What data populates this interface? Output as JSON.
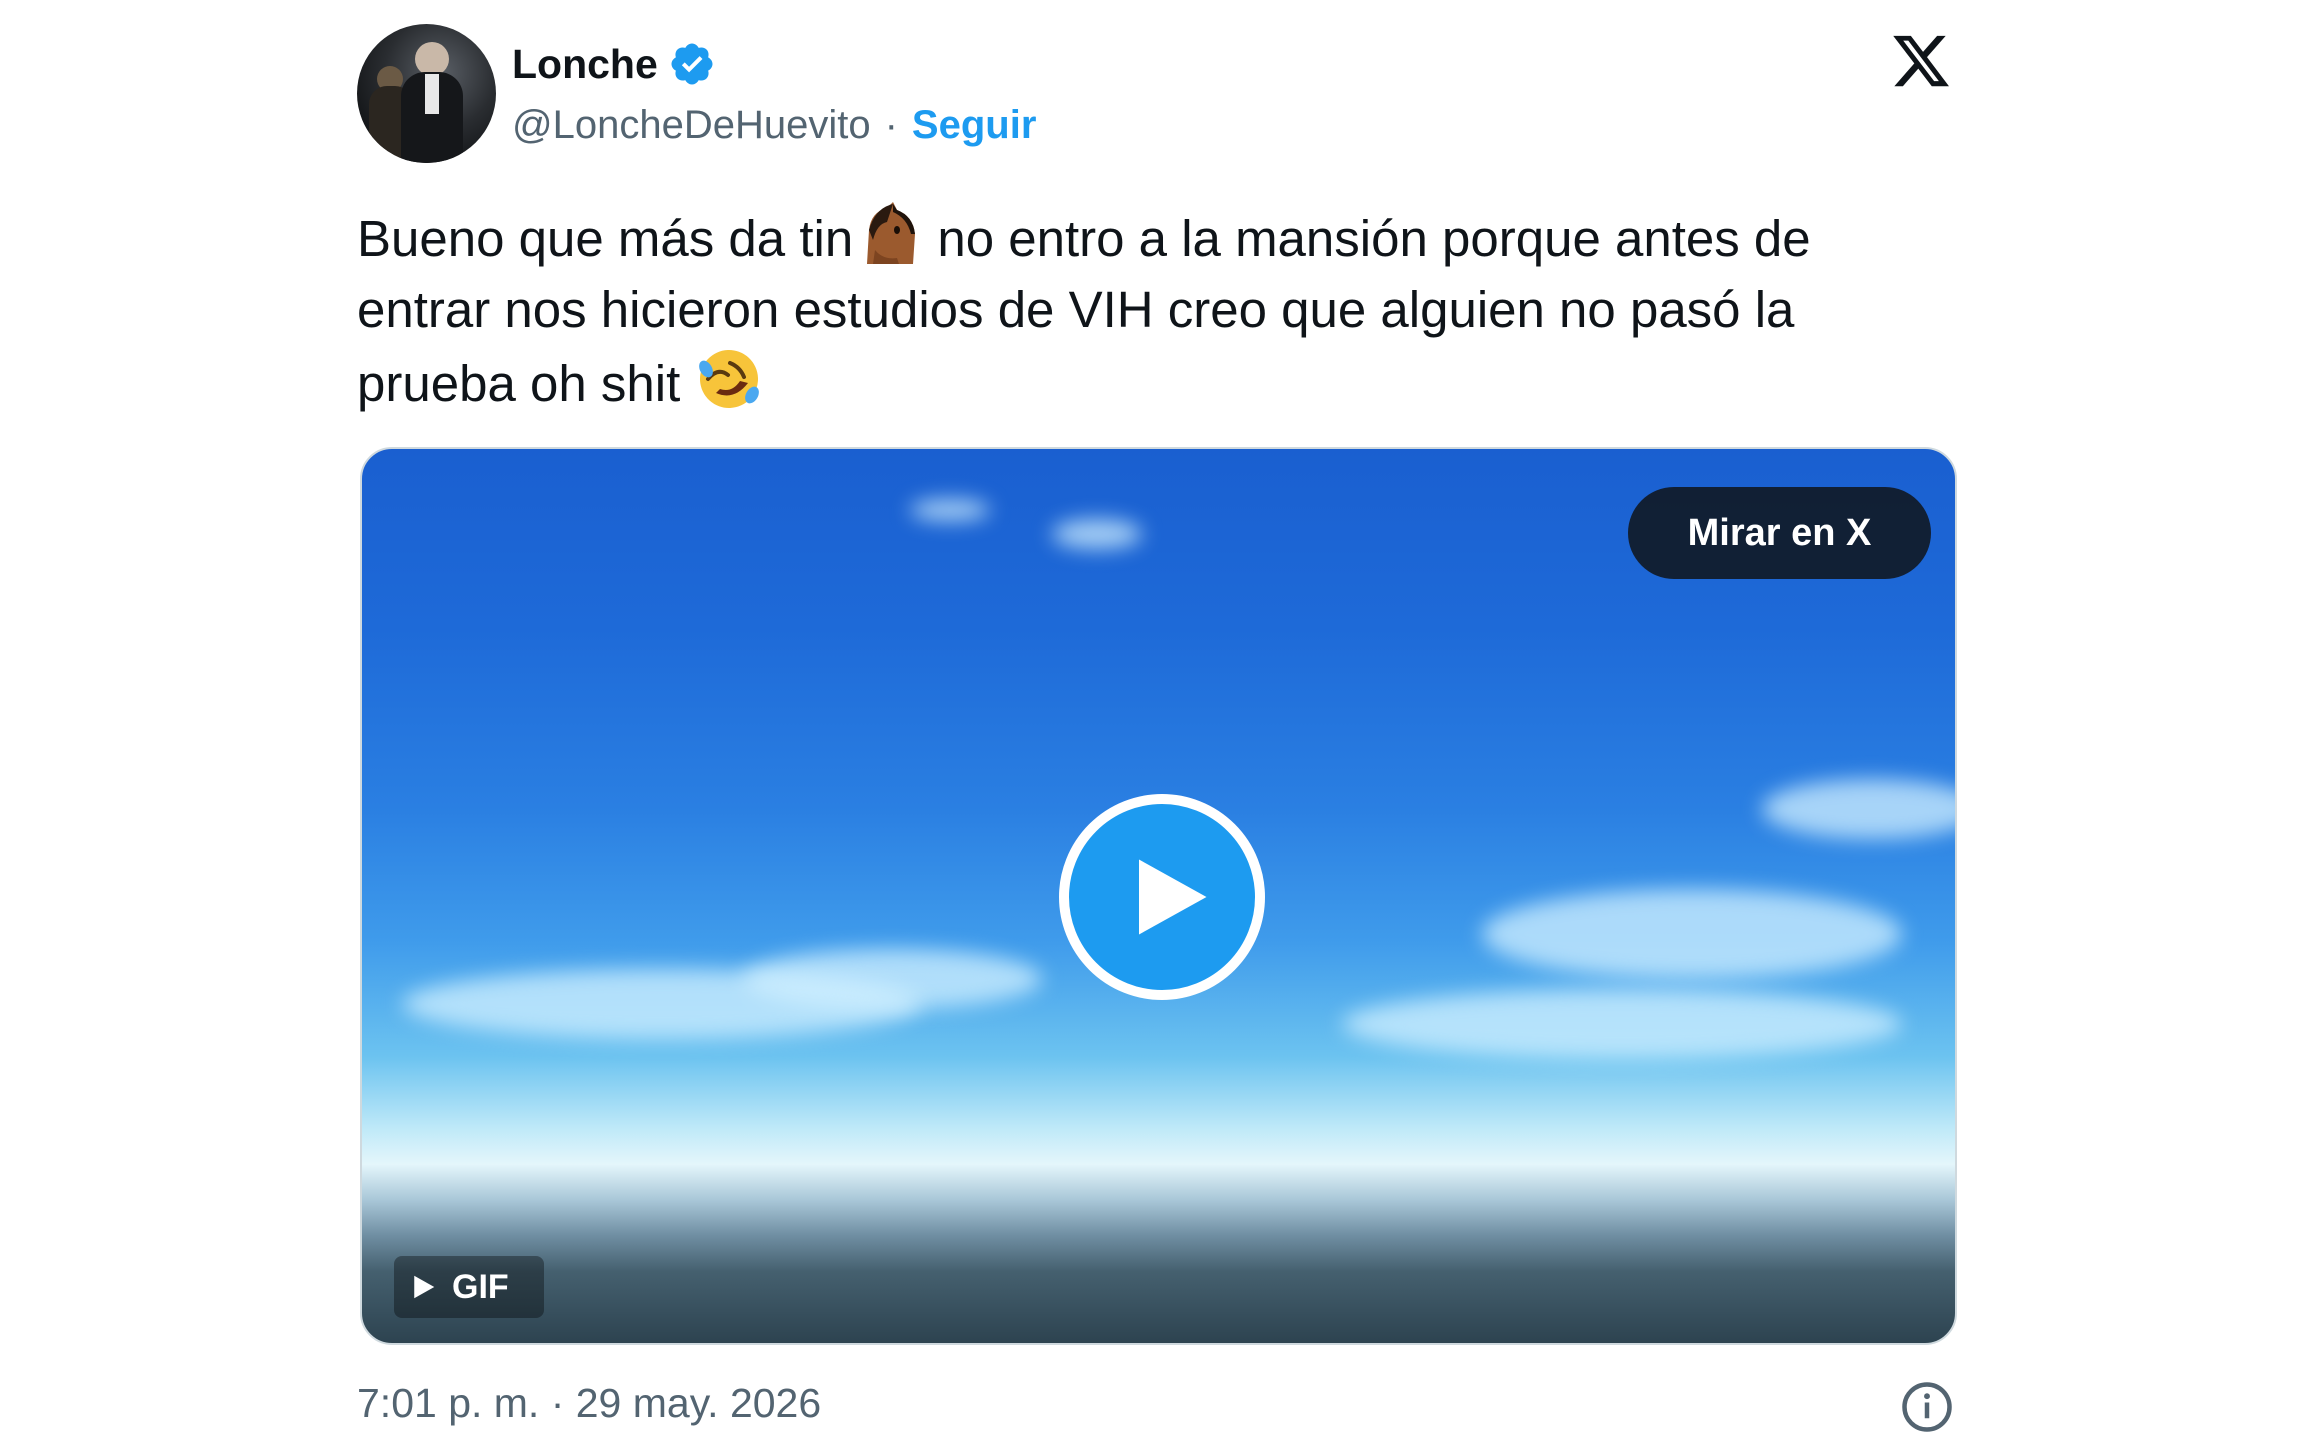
{
  "author": {
    "name": "Lonche",
    "handle": "@LoncheDeHuevito",
    "separator": "·",
    "follow_label": "Seguir",
    "verified": true
  },
  "tweet": {
    "text_part1": "Bueno que más da tin",
    "text_part2": " no entro a la mansión porque antes de entrar nos hicieron estudios de VIH creo que alguien no pasó la prueba oh shit ",
    "emoji_1": "horse-face-emoji",
    "emoji_2": "rolling-on-floor-laughing-emoji"
  },
  "media": {
    "type": "GIF",
    "watch_label": "Mirar en X",
    "gif_label": "GIF"
  },
  "footer": {
    "timestamp": "7:01 p. m. · 29 may. 2026"
  },
  "colors": {
    "accent": "#1d9bf0",
    "text": "#0f1419",
    "secondary": "#536471"
  }
}
